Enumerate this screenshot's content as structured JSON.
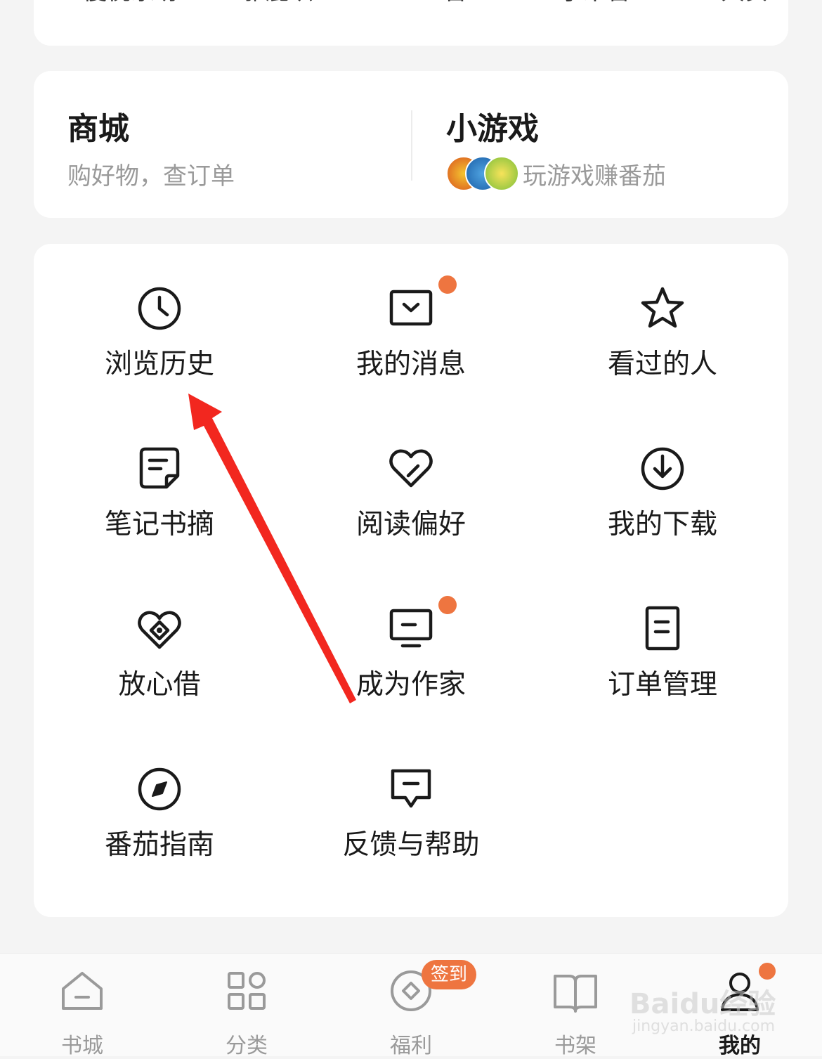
{
  "top_list": [
    "優悦家纺",
    "雅鹿织…",
    "TCL言…",
    "小米言…",
    "大安…"
  ],
  "mall": {
    "title": "商城",
    "subtitle": "购好物，查订单"
  },
  "game": {
    "title": "小游戏",
    "subtitle": "玩游戏赚番茄"
  },
  "menu": [
    {
      "label": "浏览历史",
      "icon": "clock-icon",
      "dot": false
    },
    {
      "label": "我的消息",
      "icon": "message-icon",
      "dot": true
    },
    {
      "label": "看过的人",
      "icon": "star-icon",
      "dot": false
    },
    {
      "label": "笔记书摘",
      "icon": "note-icon",
      "dot": false
    },
    {
      "label": "阅读偏好",
      "icon": "heart-icon",
      "dot": false
    },
    {
      "label": "我的下载",
      "icon": "download-icon",
      "dot": false
    },
    {
      "label": "放心借",
      "icon": "loan-icon",
      "dot": false
    },
    {
      "label": "成为作家",
      "icon": "monitor-icon",
      "dot": true
    },
    {
      "label": "订单管理",
      "icon": "order-icon",
      "dot": false
    },
    {
      "label": "番茄指南",
      "icon": "compass-icon",
      "dot": false
    },
    {
      "label": "反馈与帮助",
      "icon": "feedback-icon",
      "dot": false
    }
  ],
  "nav": {
    "tabs": [
      {
        "label": "书城",
        "icon": "home-icon"
      },
      {
        "label": "分类",
        "icon": "grid-icon"
      },
      {
        "label": "福利",
        "icon": "welfare-icon"
      },
      {
        "label": "书架",
        "icon": "book-icon"
      },
      {
        "label": "我的",
        "icon": "profile-icon",
        "active": true
      }
    ],
    "badge": "签到"
  },
  "watermark": {
    "logo": "Baidu经验",
    "url": "jingyan.baidu.com"
  },
  "colors": {
    "accent": "#ee7540",
    "annotation_arrow": "#f2271f"
  }
}
